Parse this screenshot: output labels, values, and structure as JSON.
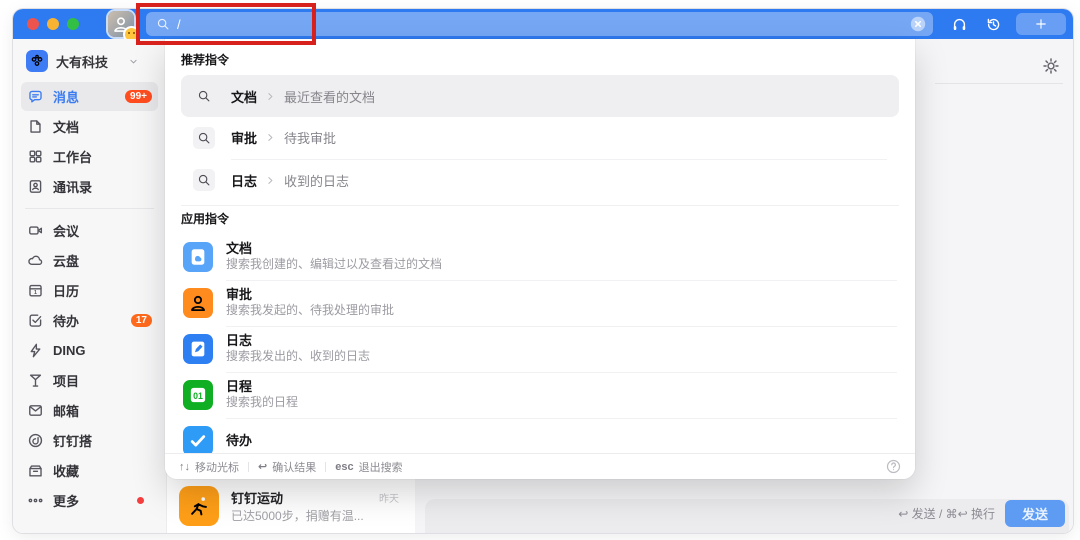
{
  "window": {
    "traffic_lights": [
      {
        "name": "close",
        "color": "#ee544e"
      },
      {
        "name": "minimize",
        "color": "#f8b332"
      },
      {
        "name": "zoom",
        "color": "#32bf43"
      }
    ]
  },
  "topbar": {
    "bg_color": "#2e7af0",
    "avatar_icon": "user-avatar",
    "search": {
      "icon": "search-icon",
      "value": "/",
      "clear_icon": "close-circle-icon"
    },
    "actions": [
      {
        "key": "support",
        "icon": "headset-icon"
      },
      {
        "key": "history",
        "icon": "history-icon"
      },
      {
        "key": "new",
        "icon": "plus-icon"
      }
    ]
  },
  "annotation": {
    "shape": "highlight-box",
    "color": "#d6211d"
  },
  "sidebar": {
    "org": {
      "name": "大有科技",
      "logo_icon": "org-team-icon",
      "chevron_icon": "chevron-down-icon"
    },
    "items": [
      {
        "key": "messages",
        "label": "消息",
        "icon": "chat-icon",
        "badge": "99+",
        "badge_color": "#ff4d1f",
        "active": true
      },
      {
        "key": "docs",
        "label": "文档",
        "icon": "doc-icon"
      },
      {
        "key": "workbench",
        "label": "工作台",
        "icon": "grid-icon"
      },
      {
        "key": "contacts",
        "label": "通讯录",
        "icon": "contacts-icon"
      },
      {
        "divider": true
      },
      {
        "key": "meeting",
        "label": "会议",
        "icon": "meeting-icon"
      },
      {
        "key": "drive",
        "label": "云盘",
        "icon": "cloud-icon"
      },
      {
        "key": "calendar",
        "label": "日历",
        "icon": "calendar-icon"
      },
      {
        "key": "todo",
        "label": "待办",
        "icon": "todo-icon",
        "badge": "17",
        "badge_color": "#ff6a1c"
      },
      {
        "key": "ding",
        "label": "DING",
        "icon": "bolt-icon"
      },
      {
        "key": "project",
        "label": "项目",
        "icon": "project-icon"
      },
      {
        "key": "mail",
        "label": "邮箱",
        "icon": "mail-icon"
      },
      {
        "key": "dingda",
        "label": "钉钉搭",
        "icon": "dingda-icon"
      },
      {
        "key": "favorites",
        "label": "收藏",
        "icon": "favorite-box-icon"
      },
      {
        "key": "more",
        "label": "更多",
        "icon": "more-dots-icon",
        "dot": true,
        "dot_color": "#f53f3f"
      }
    ]
  },
  "search_panel": {
    "recommended": {
      "header": "推荐指令",
      "items": [
        {
          "term": "文档",
          "sub": "最近查看的文档",
          "icon": "search-icon",
          "active": true
        },
        {
          "term": "审批",
          "sub": "待我审批",
          "icon": "search-icon"
        },
        {
          "term": "日志",
          "sub": "收到的日志",
          "icon": "search-icon"
        }
      ]
    },
    "apps": {
      "header": "应用指令",
      "items": [
        {
          "name": "文档",
          "desc": "搜索我创建的、编辑过以及查看过的文档",
          "icon": "app-doc-icon",
          "color": "#57a4f8"
        },
        {
          "name": "审批",
          "desc": "搜索我发起的、待我处理的审批",
          "icon": "app-approve-icon",
          "color": "#ff8a1e"
        },
        {
          "name": "日志",
          "desc": "搜索我发出的、收到的日志",
          "icon": "app-log-icon",
          "color": "#2d7ff2"
        },
        {
          "name": "日程",
          "desc": "搜索我的日程",
          "icon": "app-schedule-icon",
          "color": "#0fae23"
        },
        {
          "name": "待办",
          "icon": "app-todo-icon",
          "color": "#2e9cf6"
        }
      ]
    },
    "footer": {
      "hints": [
        {
          "key": "↑↓",
          "label": "移动光标"
        },
        {
          "key": "↩",
          "label": "确认结果"
        },
        {
          "key": "esc",
          "label": "退出搜索"
        }
      ],
      "help_icon": "question-icon"
    }
  },
  "chat": {
    "header": {
      "settings_icon": "gear-icon"
    },
    "list_item": {
      "title": "钉钉运动",
      "time": "昨天",
      "preview": "已达5000步，捐赠有温...",
      "icon": "runner-icon",
      "icon_color": "#ff9f18"
    },
    "composer": {
      "hint": "↩ 发送 / ⌘↩ 换行",
      "send_label": "发送"
    }
  }
}
